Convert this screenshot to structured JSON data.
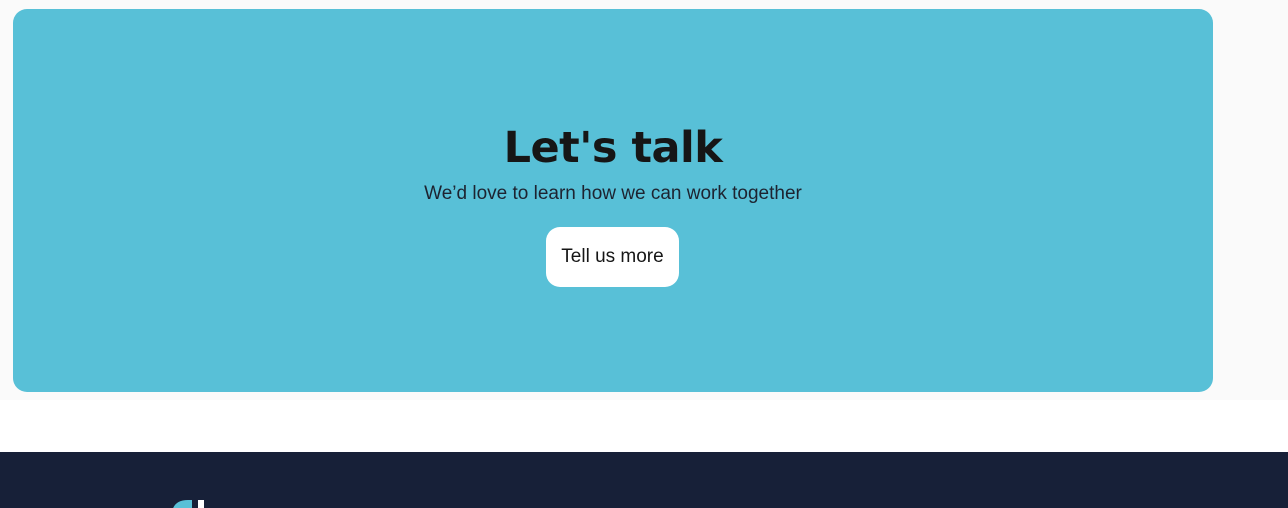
{
  "cta": {
    "title": "Let's talk",
    "subtitle": "We’d love to learn how we can work together",
    "button_label": "Tell us more"
  },
  "colors": {
    "card_background": "#58c0d7",
    "footer_background": "#172038",
    "button_background": "#ffffff",
    "heading_text": "#161616"
  }
}
